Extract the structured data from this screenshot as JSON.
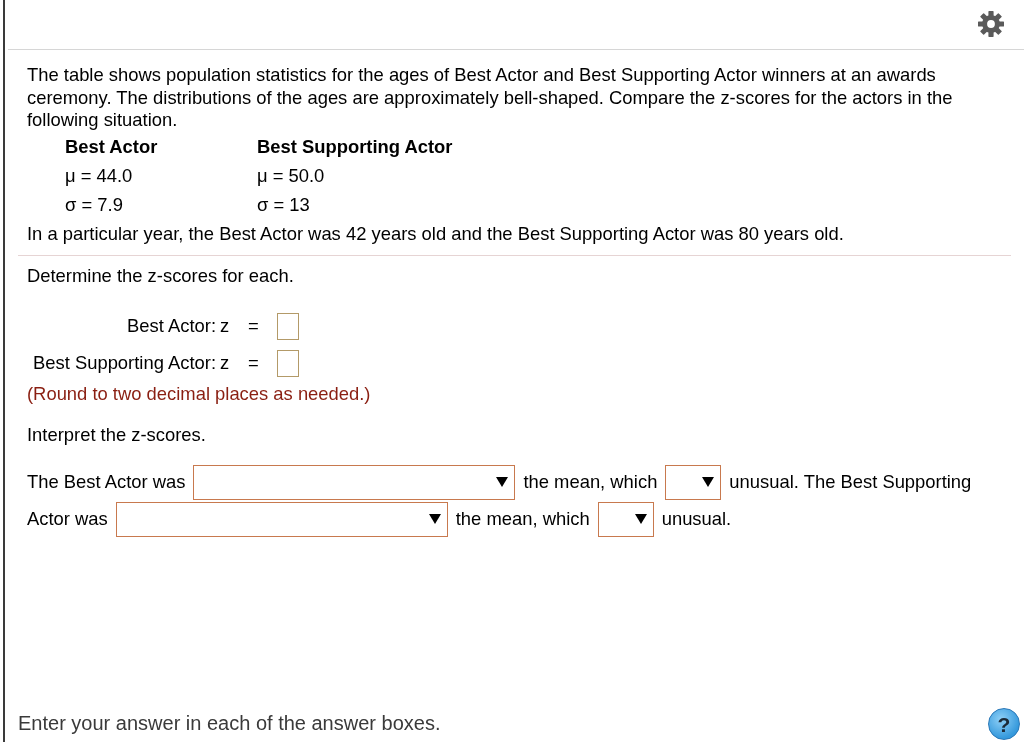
{
  "question": {
    "intro": "The table shows population statistics for the ages of Best Actor and Best Supporting Actor winners at an awards ceremony. The distributions of the ages are approximately bell-shaped. Compare the z-scores for the actors in the following situation.",
    "table": {
      "columns": [
        "Best Actor",
        "Best Supporting Actor"
      ],
      "rows": [
        [
          "μ = 44.0",
          "μ = 50.0"
        ],
        [
          "σ = 7.9",
          "σ = 13"
        ]
      ]
    },
    "situation": "In a particular year, the Best Actor was 42 years old and the Best Supporting Actor was 80 years old."
  },
  "part_1": {
    "prompt": "Determine the z-scores for each.",
    "answers": [
      {
        "label": "Best Actor:",
        "variable": "z",
        "sign": "="
      },
      {
        "label": "Best Supporting Actor:",
        "variable": "z",
        "sign": "="
      }
    ],
    "note": "(Round to two decimal places as needed.)"
  },
  "part_2": {
    "prompt": "Interpret the z-scores.",
    "lines": [
      {
        "lead": "The Best Actor was",
        "middle": "the mean, which",
        "tail": "unusual. The Best Supporting"
      },
      {
        "lead": "Actor was",
        "middle": "the mean, which",
        "tail": "unusual."
      }
    ]
  },
  "footer": {
    "instruction": "Enter your answer in each of the answer boxes.",
    "help_button": "?"
  }
}
